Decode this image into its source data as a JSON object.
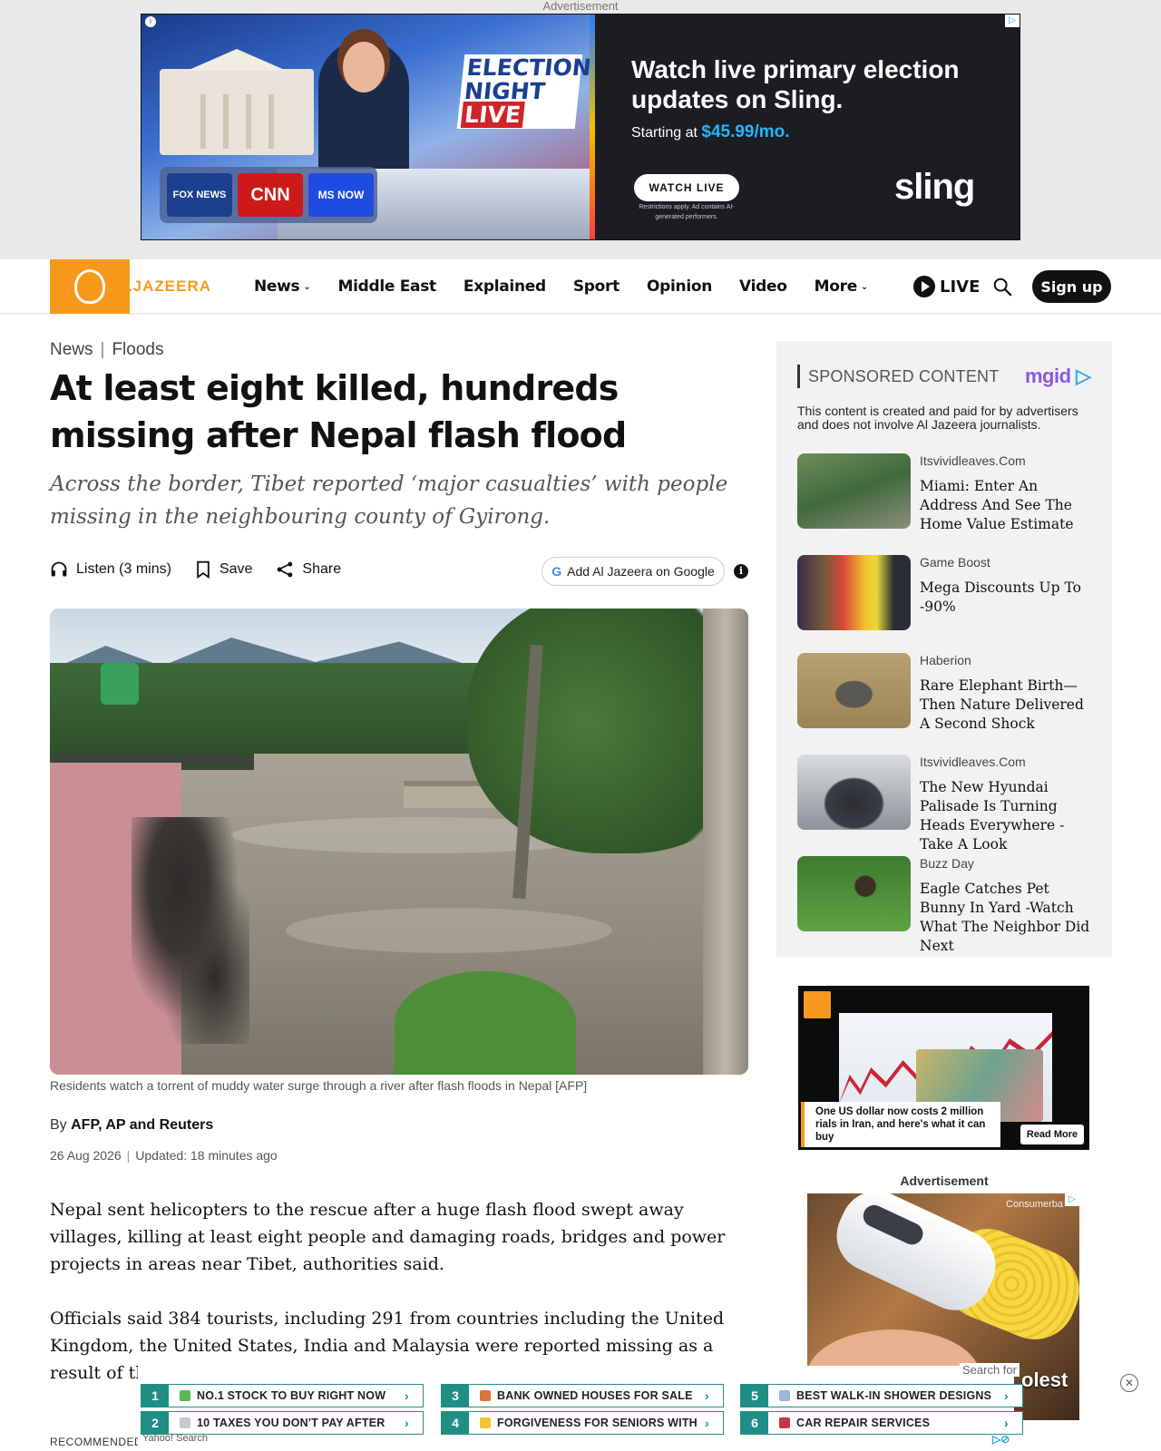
{
  "top_ad": {
    "label": "Advertisement",
    "election_line1": "ELECTION",
    "election_line2": "NIGHT",
    "election_live": "LIVE",
    "network1": "FOX NEWS",
    "network2": "CNN",
    "network3": "MS NOW",
    "headline": "Watch live primary election updates on Sling.",
    "sub_prefix": "Starting at ",
    "price": "$45.99/mo.",
    "cta": "WATCH LIVE",
    "fine_print": "Restrictions apply. Ad contains AI-generated performers.",
    "brand": "sling"
  },
  "header": {
    "logo_text": "ALJAZEERA",
    "nav": [
      {
        "label": "News",
        "dropdown": true
      },
      {
        "label": "Middle East",
        "dropdown": false
      },
      {
        "label": "Explained",
        "dropdown": false
      },
      {
        "label": "Sport",
        "dropdown": false
      },
      {
        "label": "Opinion",
        "dropdown": false
      },
      {
        "label": "Video",
        "dropdown": false
      },
      {
        "label": "More",
        "dropdown": true
      }
    ],
    "live_label": "LIVE",
    "signup_label": "Sign up",
    "accent": "#f79a1c"
  },
  "article": {
    "breadcrumb": [
      "News",
      "Floods"
    ],
    "headline": "At least eight killed, hundreds missing after Nepal flash flood",
    "dek": "Across the border, Tibet reported ‘major casualties’ with people missing in the neighbouring county of Gyirong.",
    "actions": {
      "listen": "Listen (3 mins)",
      "save": "Save",
      "share": "Share",
      "google": "Add Al Jazeera on Google"
    },
    "caption": "Residents watch a torrent of muddy water surge through a river after flash floods in Nepal [AFP]",
    "byline_prefix": "By ",
    "byline_authors": "AFP, AP and Reuters",
    "date": "26 Aug 2026",
    "updated": "Updated: 18 minutes ago",
    "paragraphs": [
      "Nepal sent helicopters to the rescue after a huge flash flood swept away villages, killing at least eight people and damaging roads, bridges and power projects in areas near Tibet, authorities said.",
      "Officials said 384 tourists, including 291 from countries including the United Kingdom, the United States, India and Malaysia were reported missing as a result of the flash flood on Wednesday."
    ],
    "recommended_label": "RECOMMENDED STORIES"
  },
  "sponsored": {
    "heading": "SPONSORED CONTENT",
    "provider": "mgid",
    "note": "This content is created and paid for by advertisers and does not involve Al Jazeera journalists.",
    "items": [
      {
        "source": "Itsvividleaves.Com",
        "title": "Miami: Enter An Address And See The Home Value Estimate"
      },
      {
        "source": "Game Boost",
        "title": "Mega Discounts Up To -90%"
      },
      {
        "source": "Haberion",
        "title": "Rare Elephant Birth—Then Nature Delivered A Second Shock"
      },
      {
        "source": "Itsvividleaves.Com",
        "title": "The New Hyundai Palisade Is Turning Heads Everywhere - Take A Look"
      },
      {
        "source": "Buzz Day",
        "title": "Eagle Catches Pet Bunny In Yard -Watch What The Neighbor Did Next"
      }
    ]
  },
  "video_ad": {
    "caption": "One US dollar now costs 2 million rials in Iran, and here's what it can buy",
    "cta": "Read More"
  },
  "side_ad": {
    "label": "Advertisement",
    "brand": "Consumerba",
    "headline_fragment": "olest"
  },
  "yahoo_bar": {
    "search_label": "Search for",
    "items": [
      {
        "num": "1",
        "label": "NO.1 STOCK TO BUY RIGHT NOW"
      },
      {
        "num": "2",
        "label": "10 TAXES YOU DON'T PAY AFTER"
      },
      {
        "num": "3",
        "label": "BANK OWNED HOUSES FOR SALE"
      },
      {
        "num": "4",
        "label": "FORGIVENESS FOR SENIORS WITH"
      },
      {
        "num": "5",
        "label": "BEST WALK-IN SHOWER DESIGNS"
      },
      {
        "num": "6",
        "label": "CAR REPAIR SERVICES"
      }
    ],
    "footer": "Yahoo! Search",
    "close": "✕"
  }
}
